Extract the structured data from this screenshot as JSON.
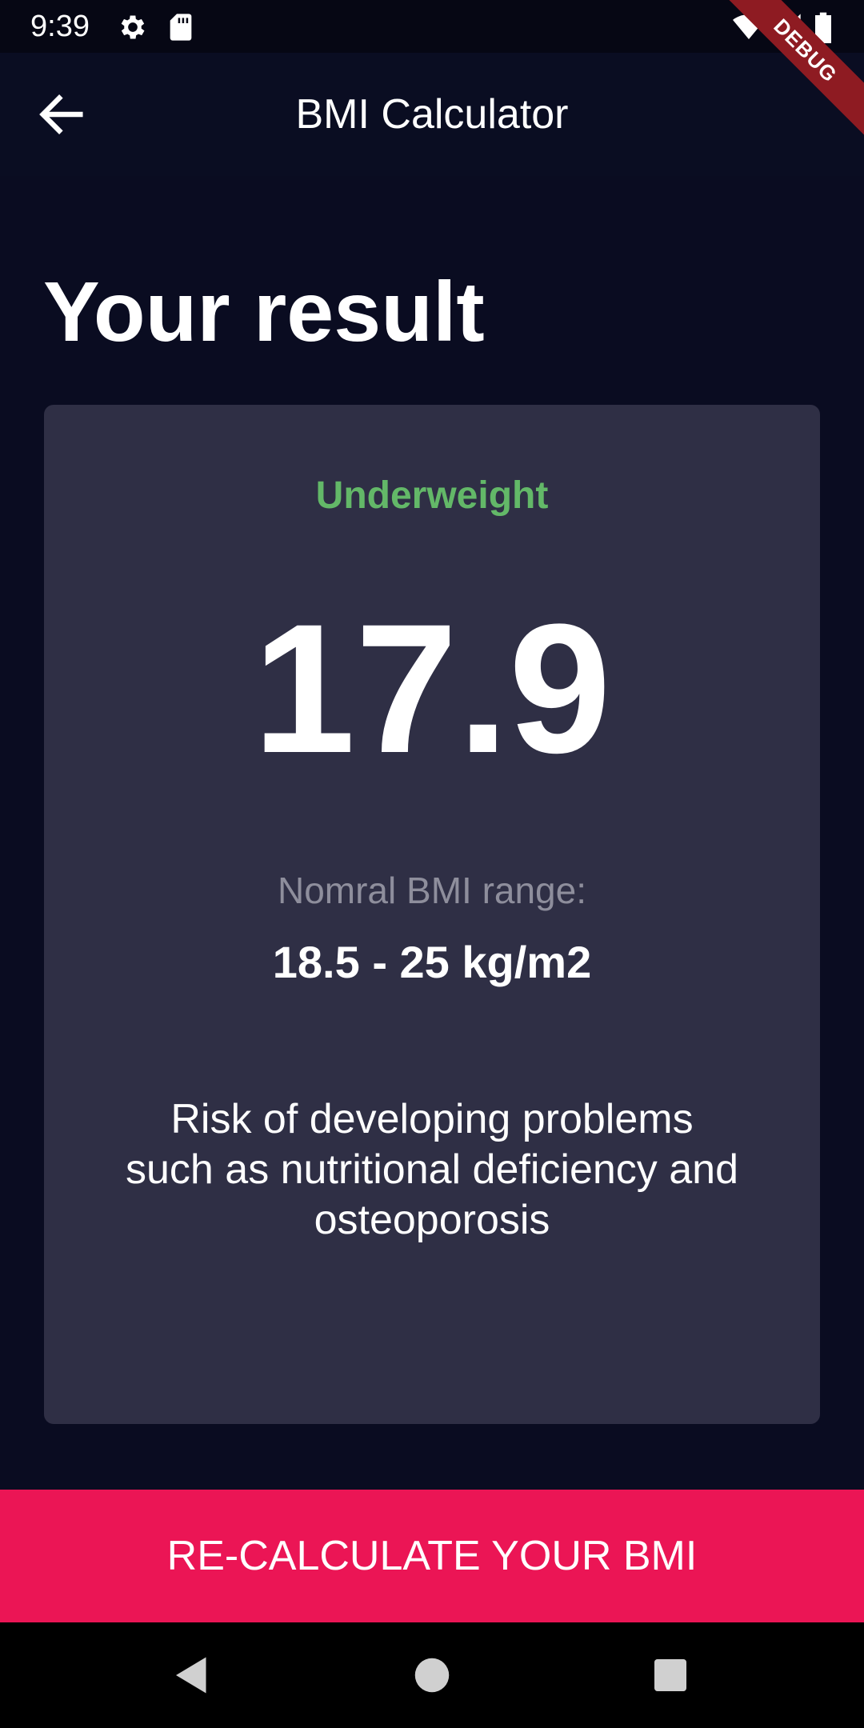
{
  "status_bar": {
    "time": "9:39",
    "icons": [
      "gear-icon",
      "sd-card-icon",
      "wifi-icon",
      "signal-icon",
      "battery-icon"
    ]
  },
  "debug_banner": {
    "label": "DEBUG"
  },
  "app_bar": {
    "title": "BMI Calculator",
    "back_icon": "arrow-back-icon"
  },
  "page": {
    "heading": "Your result"
  },
  "result": {
    "category": "Underweight",
    "bmi": "17.9",
    "range_label": "Nomral BMI range:",
    "range_value": "18.5 - 25 kg/m2",
    "interpretation": "Risk of developing problems such as nutritional deficiency and osteoporosis"
  },
  "action": {
    "recalculate_label": "RE-CALCULATE YOUR BMI"
  },
  "nav_bar": {
    "icons": [
      "back-triangle-icon",
      "home-circle-icon",
      "recents-square-icon"
    ]
  },
  "colors": {
    "background": "#0A0C21",
    "card": "#2F2F45",
    "category": "#63B868",
    "accent": "#EB1555",
    "debug": "#8E1B22"
  }
}
